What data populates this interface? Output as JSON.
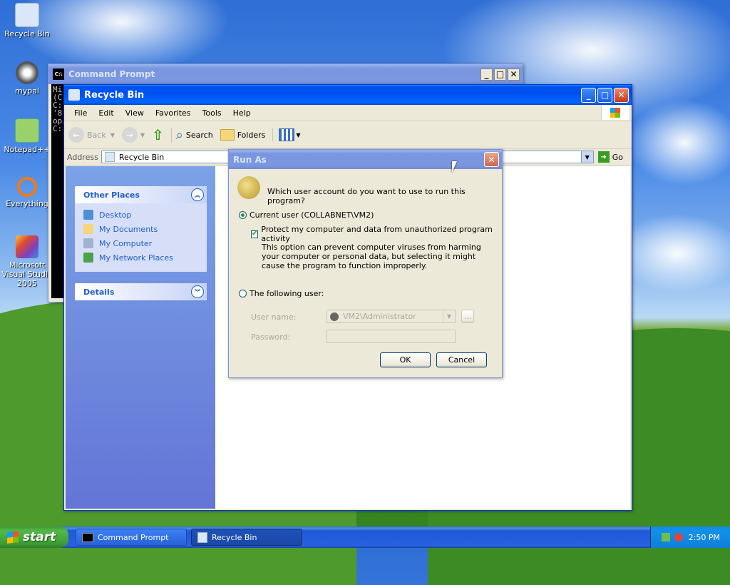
{
  "desktop": {
    "icons": [
      {
        "label": "Recycle Bin"
      },
      {
        "label": "mypal"
      },
      {
        "label": "Notepad++"
      },
      {
        "label": "Everything"
      },
      {
        "label": "Microsoft Visual Studio 2005"
      }
    ]
  },
  "cmd_window": {
    "title": "Command Prompt",
    "lines": [
      "Mi",
      "(C",
      "",
      "C:",
      "'8",
      "op",
      "",
      "C:"
    ]
  },
  "explorer": {
    "title": "Recycle Bin",
    "menu": [
      "File",
      "Edit",
      "View",
      "Favorites",
      "Tools",
      "Help"
    ],
    "toolbar": {
      "back": "Back",
      "search": "Search",
      "folders": "Folders"
    },
    "address": {
      "label": "Address",
      "value": "Recycle Bin",
      "go": "Go"
    },
    "other_places": {
      "heading": "Other Places",
      "links": [
        "Desktop",
        "My Documents",
        "My Computer",
        "My Network Places"
      ]
    },
    "details": {
      "heading": "Details"
    }
  },
  "run_as": {
    "title": "Run As",
    "question": "Which user account do you want to use to run this program?",
    "current_user_label": "Current user (COLLABNET\\VM2)",
    "protect_label": "Protect my computer and data from unauthorized program activity",
    "protect_note": "This option can prevent computer viruses from harming your computer or personal data, but selecting it might cause the program to function improperly.",
    "following_user_label": "The following user:",
    "username_label": "User name:",
    "username_value": "VM2\\Administrator",
    "password_label": "Password:",
    "browse_label": "...",
    "ok": "OK",
    "cancel": "Cancel",
    "current_user_selected": true,
    "protect_checked": true
  },
  "taskbar": {
    "start": "start",
    "tasks": [
      "Command Prompt",
      "Recycle Bin"
    ],
    "clock": "2:50 PM"
  },
  "colors": {
    "xp_blue": "#0053ee",
    "link_blue": "#215dc6",
    "start_green": "#3b9c35"
  }
}
